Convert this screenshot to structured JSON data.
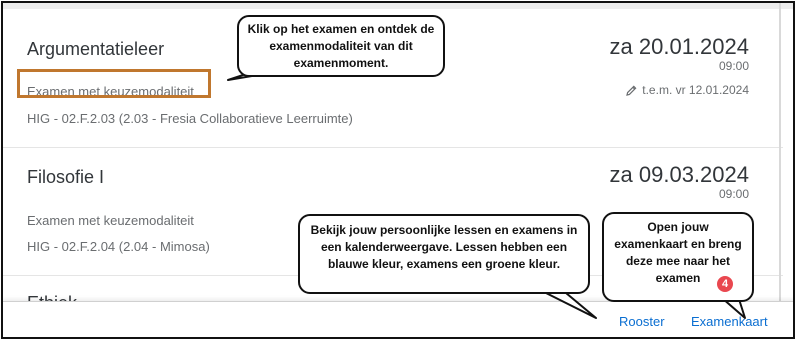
{
  "exams": [
    {
      "title": "Argumentatieleer",
      "date": "za 20.01.2024",
      "time": "09:00",
      "modality": "Examen met keuzemodaliteit",
      "until": "t.e.m. vr 12.01.2024",
      "location": "HIG - 02.F.2.03 (2.03 - Fresia Collaboratieve Leerruimte)"
    },
    {
      "title": "Filosofie I",
      "date": "za 09.03.2024",
      "time": "09:00",
      "modality": "Examen met keuzemodaliteit",
      "location": "HIG - 02.F.2.04 (2.04 - Mimosa)"
    },
    {
      "title": "Ethiek"
    }
  ],
  "bubbles": {
    "top": "Klik op het examen en ontdek de examenmodaliteit van dit examenmoment.",
    "rooster": "Bekijk jouw persoonlijke lessen en examens in een kalenderweergave. Lessen hebben een blauwe kleur, examens een groene kleur.",
    "kaart": "Open jouw examenkaart en breng deze mee naar het examen"
  },
  "badge": "4",
  "footer": {
    "rooster_label": "Rooster",
    "examenkaart_label": "Examenkaart"
  },
  "colors": {
    "link": "#0a6ed1",
    "highlight": "#c0772e",
    "badge": "#e9474f"
  }
}
